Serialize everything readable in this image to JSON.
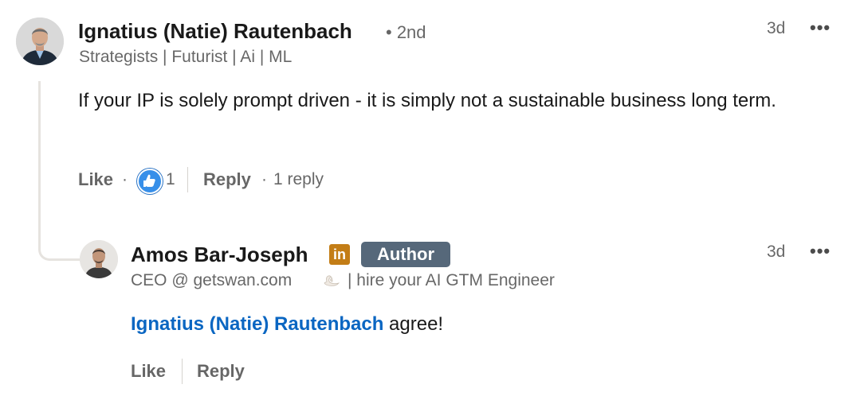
{
  "comment": {
    "author_name": "Ignatius (Natie) Rautenbach",
    "degree": "• 2nd",
    "headline": "Strategists | Futurist | Ai | ML",
    "time": "3d",
    "more": "•••",
    "text": "If your IP is solely prompt driven - it is simply not a sustainable business long term.",
    "like_label": "Like",
    "dot1": "·",
    "reaction_count": "1",
    "reply_label": "Reply",
    "dot2": "·",
    "replies_count": "1 reply",
    "reaction_icon": "thumbs-up-icon"
  },
  "reply": {
    "author_name": "Amos Bar-Joseph",
    "linkedin_badge": "in",
    "author_badge": "Author",
    "headline_start": "CEO @ getswan.com",
    "headline_end": "| hire your AI GTM Engineer",
    "time": "3d",
    "more": "•••",
    "mention": "Ignatius (Natie) Rautenbach",
    "text": " agree!",
    "like_label": "Like",
    "reply_label": "Reply"
  },
  "colors": {
    "link": "#0a66c2",
    "badge_bg": "#56687a",
    "like_blue": "#378fe9",
    "thread_line": "#e6e3df"
  }
}
